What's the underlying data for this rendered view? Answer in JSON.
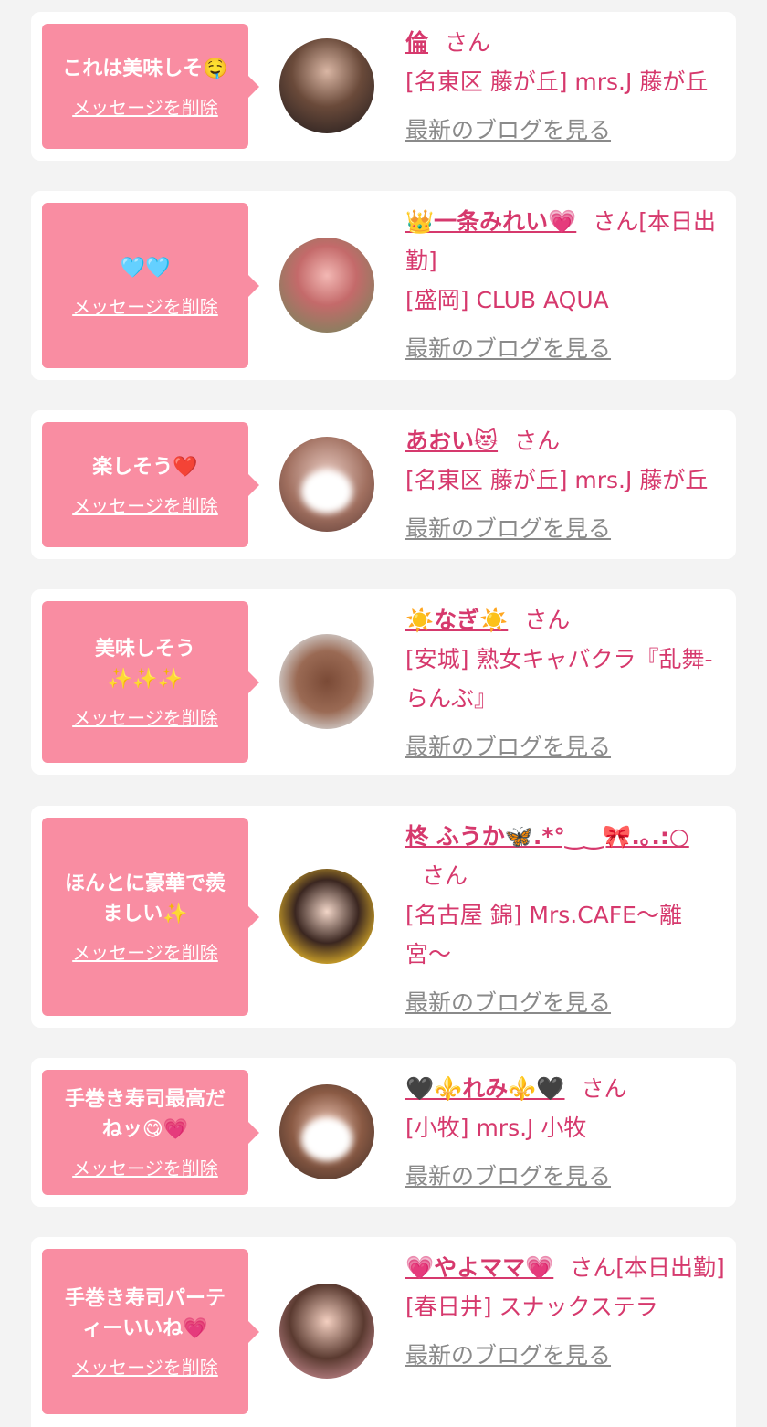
{
  "delete_label": "メッセージを削除",
  "blog_label": "最新のブログを見る",
  "san_suffix": "さん",
  "cards": [
    {
      "message": "これは美味しそ🤤",
      "name": "倫",
      "status": "",
      "shop": "[名東区 藤が丘] mrs.J 藤が丘"
    },
    {
      "message": "🩵🩵",
      "name": "👑一条みれい💗",
      "status": "[本日出勤]",
      "shop": "[盛岡] CLUB AQUA"
    },
    {
      "message": "楽しそう❤️",
      "name": "あおい😻",
      "status": "",
      "shop": "[名東区 藤が丘] mrs.J 藤が丘"
    },
    {
      "message": "美味しそう\n✨✨✨",
      "name": "☀️なぎ☀️",
      "status": "",
      "shop": "[安城] 熟女キャバクラ『乱舞-らんぶ』"
    },
    {
      "message": "ほんとに豪華で羨\nましい✨",
      "name": "柊 ふうか🦋.*°‿‿🎀.｡.:○",
      "status": "",
      "shop": "[名古屋 錦] Mrs.CAFE〜離宮〜"
    },
    {
      "message": "手巻き寿司最高だ\nねッ😋💗",
      "name": "🖤⚜️れみ⚜️🖤",
      "status": "",
      "shop": "[小牧] mrs.J 小牧"
    },
    {
      "message": "手巻き寿司パーテ\nィーいいね💗",
      "name": "💗やよママ💗",
      "status": "[本日出勤]",
      "shop": "[春日井] スナックステラ"
    }
  ]
}
